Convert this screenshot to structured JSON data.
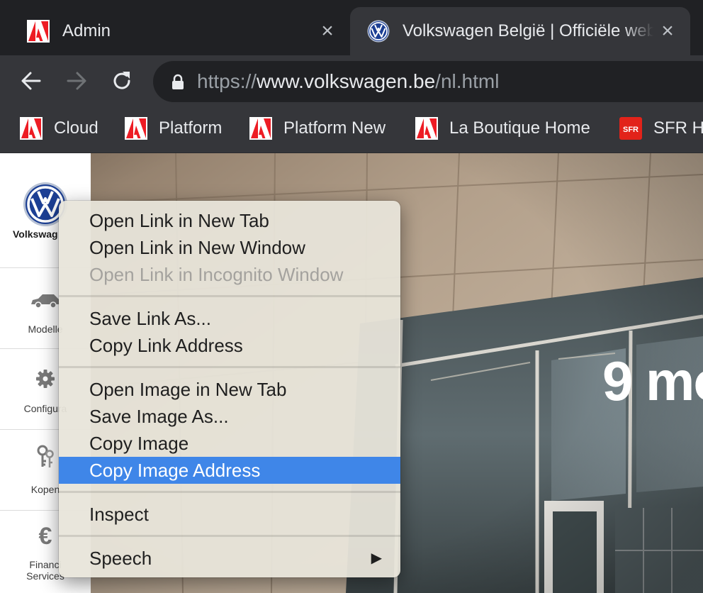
{
  "tabs": [
    {
      "title": "Admin",
      "favicon": "adobe-icon"
    },
    {
      "title": "Volkswagen België | Officiële website",
      "favicon": "vw-logo-icon"
    }
  ],
  "toolbar": {
    "url_scheme": "https://",
    "url_host": "www.volkswagen.be",
    "url_path": "/nl.html"
  },
  "bookmarks": [
    {
      "label": "Cloud",
      "icon": "adobe-icon"
    },
    {
      "label": "Platform",
      "icon": "adobe-icon"
    },
    {
      "label": "Platform New",
      "icon": "adobe-icon"
    },
    {
      "label": "La Boutique Home",
      "icon": "adobe-icon"
    },
    {
      "label": "SFR H",
      "icon": "sfr-icon",
      "icon_text": "SFR"
    }
  ],
  "sidebar": {
    "brand": "Volkswag",
    "items": [
      {
        "label": "Modelle",
        "icon": "car-icon"
      },
      {
        "label": "Configura",
        "icon": "gear-icon"
      },
      {
        "label": "Kopen",
        "icon": "keys-icon"
      },
      {
        "label": "Financi\nServices",
        "icon": "euro-icon",
        "glyph": "€"
      }
    ]
  },
  "hero": {
    "heading": "9 mo"
  },
  "context_menu": {
    "groups": [
      [
        {
          "label": "Open Link in New Tab"
        },
        {
          "label": "Open Link in New Window"
        },
        {
          "label": "Open Link in Incognito Window",
          "disabled": true
        }
      ],
      [
        {
          "label": "Save Link As..."
        },
        {
          "label": "Copy Link Address"
        }
      ],
      [
        {
          "label": "Open Image in New Tab"
        },
        {
          "label": "Save Image As..."
        },
        {
          "label": "Copy Image"
        },
        {
          "label": "Copy Image Address",
          "highlighted": true
        }
      ],
      [
        {
          "label": "Inspect"
        }
      ],
      [
        {
          "label": "Speech",
          "submenu": true,
          "arrow": "▶"
        }
      ]
    ]
  },
  "colors": {
    "tab_strip": "#202124",
    "toolbar": "#35363a",
    "menu_highlight": "#3f86e8",
    "adobe_red": "#ed1c24",
    "sfr_red": "#e2231a",
    "vw_blue": "#1c3f94"
  }
}
